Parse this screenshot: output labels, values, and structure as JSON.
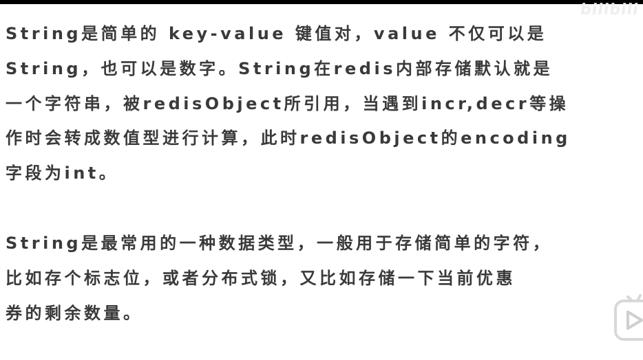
{
  "watermark": "bilibili",
  "paragraphs": [
    {
      "lines": [
        "String是简单的 key-value 键值对，value 不仅可以是",
        "String，也可以是数字。String在redis内部存储默认就是",
        "一个字符串，被redisObject所引用，当遇到incr,decr等操",
        "作时会转成数值型进行计算，此时redisObject的encoding",
        "字段为int。"
      ]
    },
    {
      "lines": [
        "String是最常用的一种数据类型，一般用于存储简单的字符，",
        "比如存个标志位，或者分布式锁，又比如存储一下当前优惠",
        "券的剩余数量。"
      ]
    }
  ],
  "icons": {
    "player": "play-icon"
  }
}
